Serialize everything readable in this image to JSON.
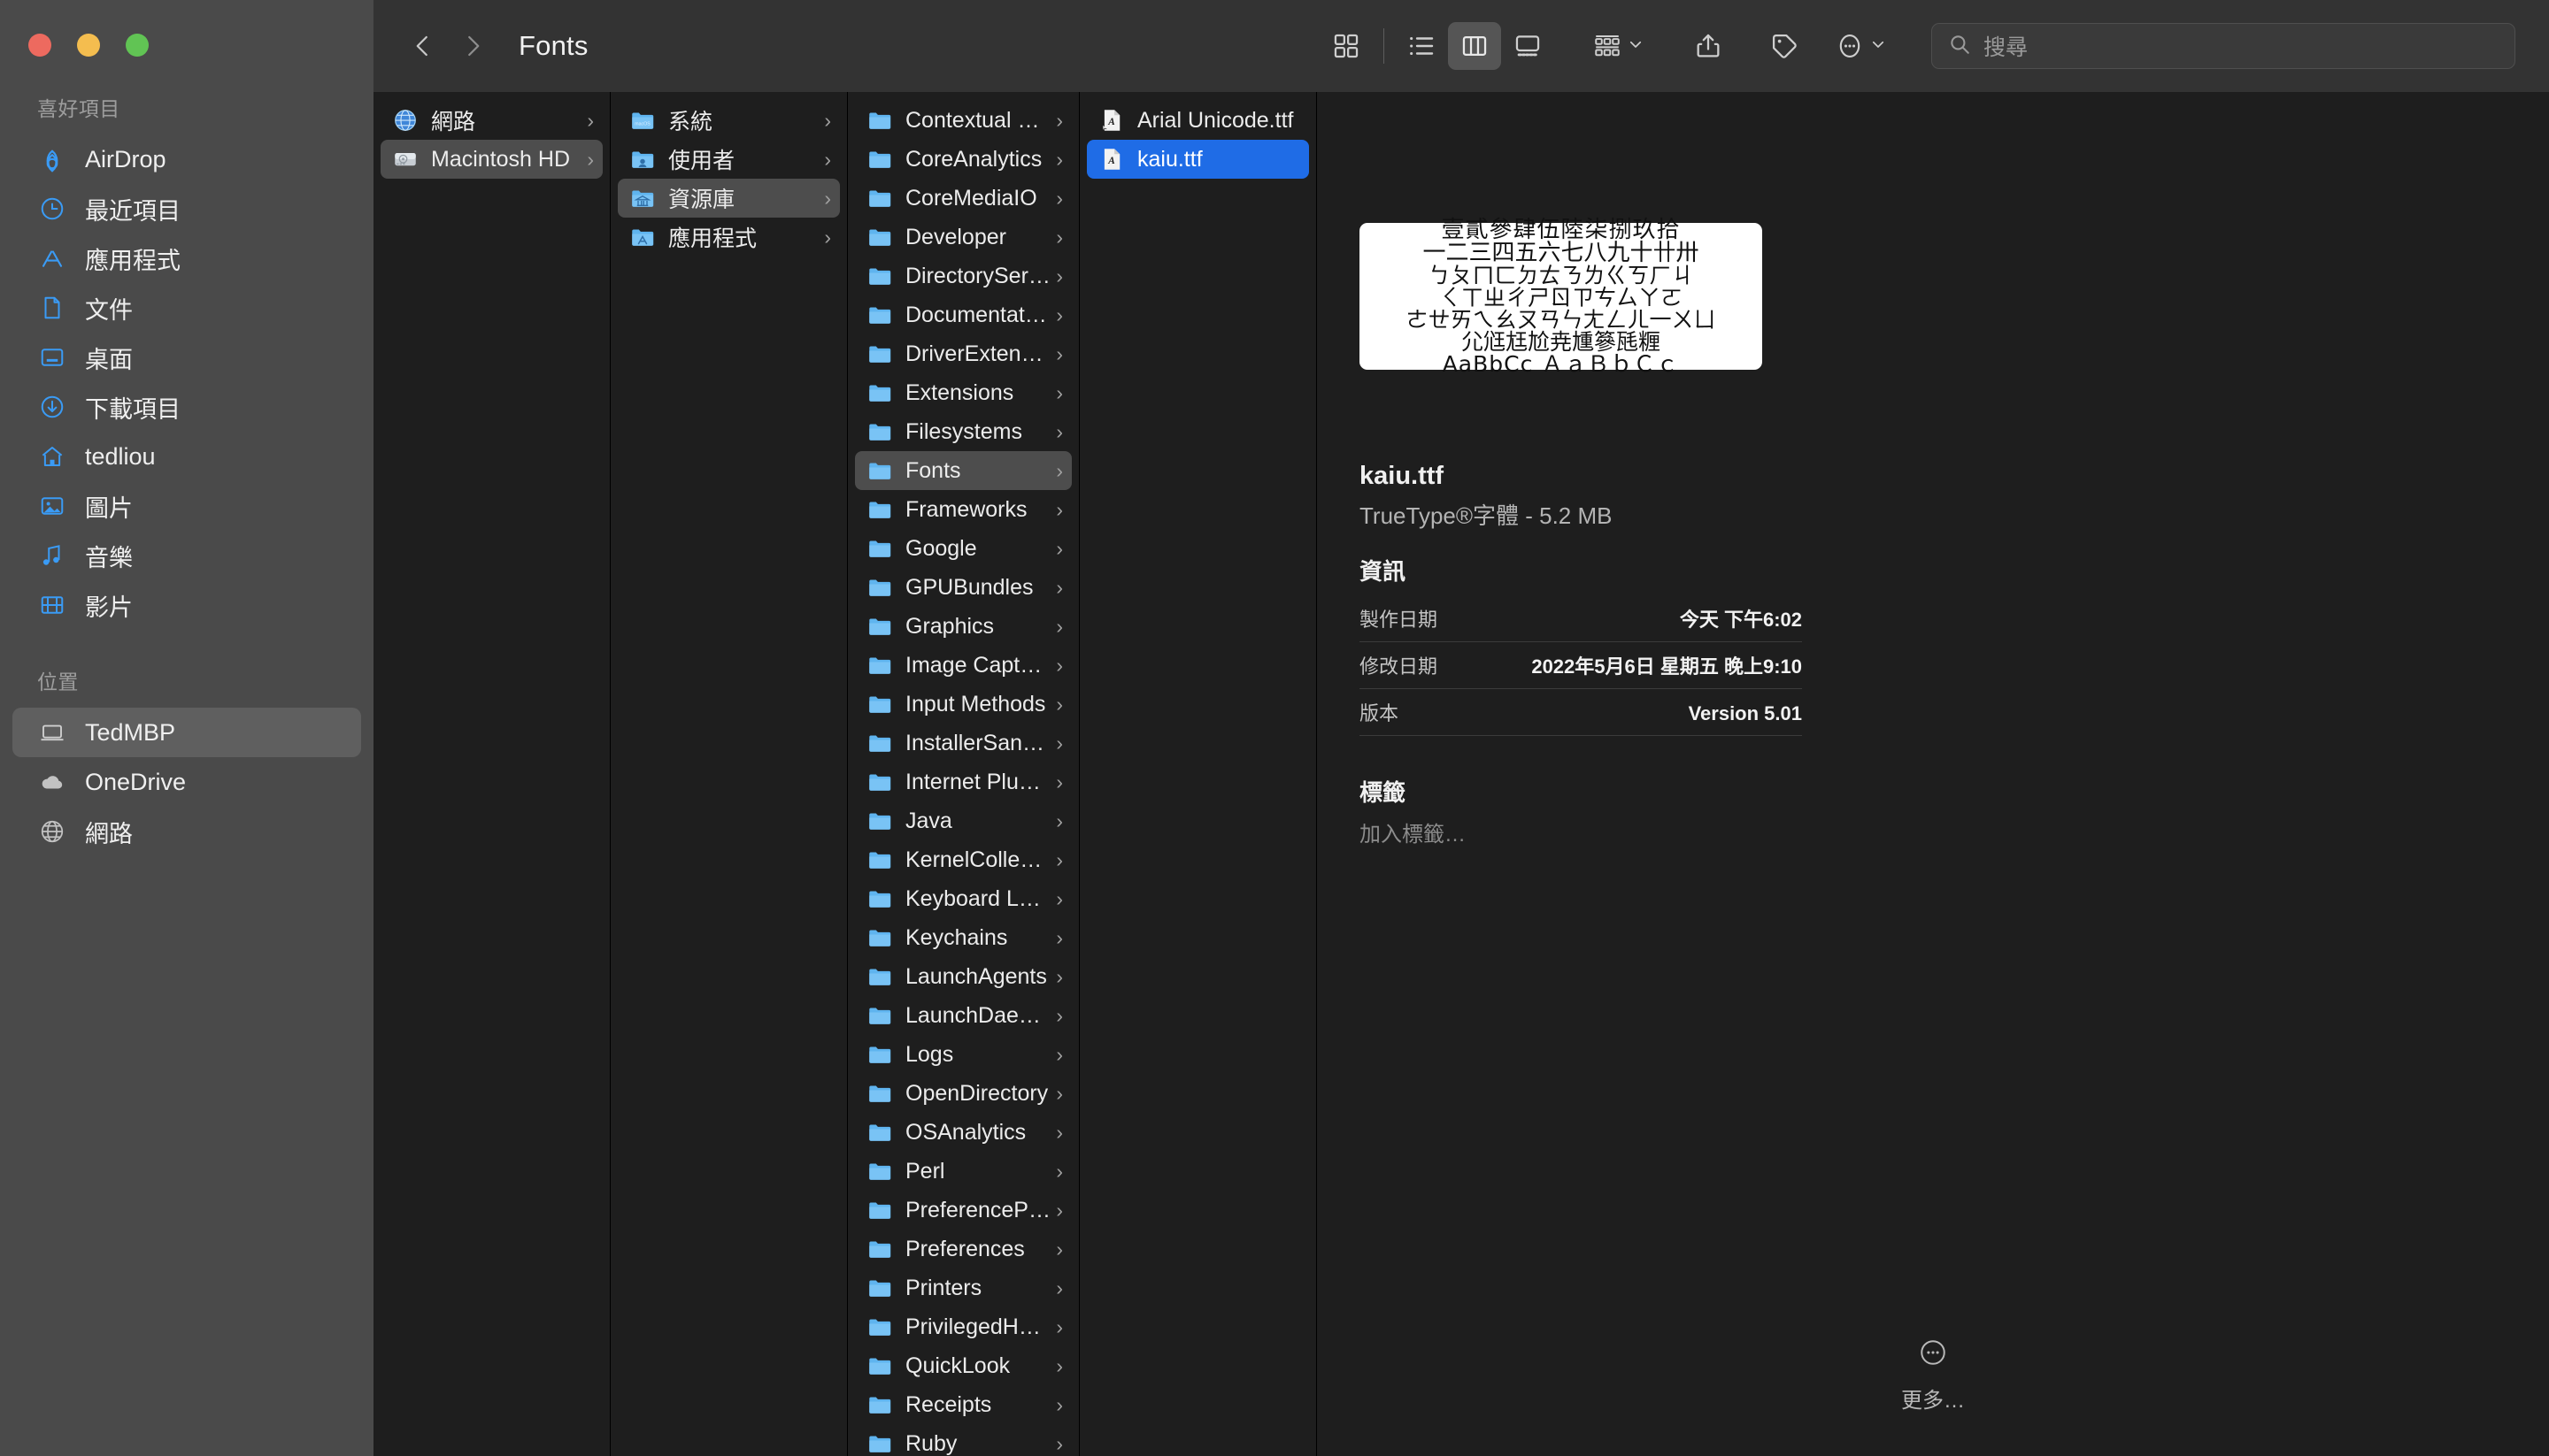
{
  "window": {
    "title": "Fonts",
    "traffic_lights": [
      "close",
      "minimize",
      "zoom"
    ]
  },
  "toolbar": {
    "back_icon": "chevron-left-icon",
    "forward_icon": "chevron-right-icon",
    "view_icon_grid": "icon-view-icon",
    "view_list": "list-view-icon",
    "view_column": "column-view-icon",
    "view_gallery": "gallery-view-icon",
    "group_icon": "group-by-icon",
    "share_icon": "share-icon",
    "tag_icon": "tag-icon",
    "more_icon": "more-actions-icon"
  },
  "search": {
    "placeholder": "搜尋",
    "value": ""
  },
  "sidebar": {
    "favorites_title": "喜好項目",
    "favorites": [
      {
        "label": "AirDrop",
        "icon": "airdrop-icon"
      },
      {
        "label": "最近項目",
        "icon": "recents-clock-icon"
      },
      {
        "label": "應用程式",
        "icon": "applications-icon"
      },
      {
        "label": "文件",
        "icon": "documents-icon"
      },
      {
        "label": "桌面",
        "icon": "desktop-icon"
      },
      {
        "label": "下載項目",
        "icon": "downloads-icon"
      },
      {
        "label": "tedliou",
        "icon": "home-icon"
      },
      {
        "label": "圖片",
        "icon": "pictures-icon"
      },
      {
        "label": "音樂",
        "icon": "music-icon"
      },
      {
        "label": "影片",
        "icon": "movies-icon"
      }
    ],
    "locations_title": "位置",
    "locations": [
      {
        "label": "TedMBP",
        "icon": "laptop-icon",
        "selected": true
      },
      {
        "label": "OneDrive",
        "icon": "cloud-icon",
        "selected": false
      },
      {
        "label": "網路",
        "icon": "globe-icon",
        "selected": false
      }
    ]
  },
  "columns": {
    "col1": [
      {
        "label": "網路",
        "icon": "network-globe-icon",
        "selected": false,
        "disclosure": "›"
      },
      {
        "label": "Macintosh HD",
        "icon": "harddisk-icon",
        "selected": true,
        "disclosure": "›"
      }
    ],
    "col2": [
      {
        "label": "系統",
        "icon": "folder-macos-icon",
        "selected": false,
        "disclosure": "›"
      },
      {
        "label": "使用者",
        "icon": "folder-users-icon",
        "selected": false,
        "disclosure": "›"
      },
      {
        "label": "資源庫",
        "icon": "folder-library-icon",
        "selected": true,
        "disclosure": "›"
      },
      {
        "label": "應用程式",
        "icon": "folder-applications-icon",
        "selected": false,
        "disclosure": "›"
      }
    ],
    "col3": [
      {
        "label": "Contextual Menu Items",
        "icon": "folder-icon",
        "selected": false,
        "disclosure": "›"
      },
      {
        "label": "CoreAnalytics",
        "icon": "folder-icon",
        "selected": false,
        "disclosure": "›"
      },
      {
        "label": "CoreMediaIO",
        "icon": "folder-icon",
        "selected": false,
        "disclosure": "›"
      },
      {
        "label": "Developer",
        "icon": "folder-icon",
        "selected": false,
        "disclosure": "›"
      },
      {
        "label": "DirectoryServices",
        "icon": "folder-icon",
        "selected": false,
        "disclosure": "›"
      },
      {
        "label": "Documentation",
        "icon": "folder-icon",
        "selected": false,
        "disclosure": "›"
      },
      {
        "label": "DriverExtensions",
        "icon": "folder-icon",
        "selected": false,
        "disclosure": "›"
      },
      {
        "label": "Extensions",
        "icon": "folder-icon",
        "selected": false,
        "disclosure": "›"
      },
      {
        "label": "Filesystems",
        "icon": "folder-icon",
        "selected": false,
        "disclosure": "›"
      },
      {
        "label": "Fonts",
        "icon": "folder-icon",
        "selected": true,
        "disclosure": "›"
      },
      {
        "label": "Frameworks",
        "icon": "folder-icon",
        "selected": false,
        "disclosure": "›"
      },
      {
        "label": "Google",
        "icon": "folder-icon",
        "selected": false,
        "disclosure": "›"
      },
      {
        "label": "GPUBundles",
        "icon": "folder-icon",
        "selected": false,
        "disclosure": "›"
      },
      {
        "label": "Graphics",
        "icon": "folder-icon",
        "selected": false,
        "disclosure": "›"
      },
      {
        "label": "Image Capture",
        "icon": "folder-icon",
        "selected": false,
        "disclosure": "›"
      },
      {
        "label": "Input Methods",
        "icon": "folder-icon",
        "selected": false,
        "disclosure": "›"
      },
      {
        "label": "InstallerSandboxes",
        "icon": "folder-icon",
        "selected": false,
        "disclosure": "›"
      },
      {
        "label": "Internet Plug-Ins",
        "icon": "folder-icon",
        "selected": false,
        "disclosure": "›"
      },
      {
        "label": "Java",
        "icon": "folder-icon",
        "selected": false,
        "disclosure": "›"
      },
      {
        "label": "KernelCollections",
        "icon": "folder-icon",
        "selected": false,
        "disclosure": "›"
      },
      {
        "label": "Keyboard Layouts",
        "icon": "folder-icon",
        "selected": false,
        "disclosure": "›"
      },
      {
        "label": "Keychains",
        "icon": "folder-icon",
        "selected": false,
        "disclosure": "›"
      },
      {
        "label": "LaunchAgents",
        "icon": "folder-icon",
        "selected": false,
        "disclosure": "›"
      },
      {
        "label": "LaunchDaemons",
        "icon": "folder-icon",
        "selected": false,
        "disclosure": "›"
      },
      {
        "label": "Logs",
        "icon": "folder-icon",
        "selected": false,
        "disclosure": "›"
      },
      {
        "label": "OpenDirectory",
        "icon": "folder-icon",
        "selected": false,
        "disclosure": "›"
      },
      {
        "label": "OSAnalytics",
        "icon": "folder-icon",
        "selected": false,
        "disclosure": "›"
      },
      {
        "label": "Perl",
        "icon": "folder-icon",
        "selected": false,
        "disclosure": "›"
      },
      {
        "label": "PreferencePanes",
        "icon": "folder-icon",
        "selected": false,
        "disclosure": "›"
      },
      {
        "label": "Preferences",
        "icon": "folder-icon",
        "selected": false,
        "disclosure": "›"
      },
      {
        "label": "Printers",
        "icon": "folder-icon",
        "selected": false,
        "disclosure": "›"
      },
      {
        "label": "PrivilegedHelperTools",
        "icon": "folder-icon",
        "selected": false,
        "disclosure": "›"
      },
      {
        "label": "QuickLook",
        "icon": "folder-icon",
        "selected": false,
        "disclosure": "›"
      },
      {
        "label": "Receipts",
        "icon": "folder-icon",
        "selected": false,
        "disclosure": "›"
      },
      {
        "label": "Ruby",
        "icon": "folder-icon",
        "selected": false,
        "disclosure": "›"
      }
    ],
    "col4": [
      {
        "label": "Arial Unicode.ttf",
        "icon": "font-file-alias-icon",
        "selected": false
      },
      {
        "label": "kaiu.ttf",
        "icon": "font-file-icon",
        "selected": true
      }
    ]
  },
  "preview": {
    "font_sample_lines": [
      "壹貳參肆伍陸柒捌玖拾",
      "一二三四五六七八九十卄卅",
      "ㄅㄆㄇㄈㄉㄊㄋㄌㄍㄎㄏㄐ",
      "ㄑㄒㄓㄔㄕㄖㄗㄘㄙㄚㄛ",
      "ㄜㄝㄞㄟㄠㄡㄢㄣㄤㄥㄦ一ㄨㄩ",
      "尣尩尪尬尭尰篸瓱糎",
      "AaBbCc ＡａＢｂＣｃ"
    ],
    "file_name": "kaiu.ttf",
    "file_kind_size": "TrueType®字體 - 5.2 MB",
    "info_title": "資訊",
    "info_rows": [
      {
        "key": "製作日期",
        "value": "今天 下午6:02"
      },
      {
        "key": "修改日期",
        "value": "2022年5月6日 星期五 晚上9:10"
      },
      {
        "key": "版本",
        "value": "Version 5.01"
      }
    ],
    "tags_title": "標籤",
    "tags_add": "加入標籤…",
    "more_label": "更多…",
    "more_icon": "more-circle-icon"
  },
  "colors": {
    "accent_blue": "#1f6ce6",
    "sidebar_bg": "#4a4a4a",
    "toolbar_bg": "#333333",
    "column_bg": "#1e1e1e",
    "selection_gray": "#4d4d4d"
  }
}
